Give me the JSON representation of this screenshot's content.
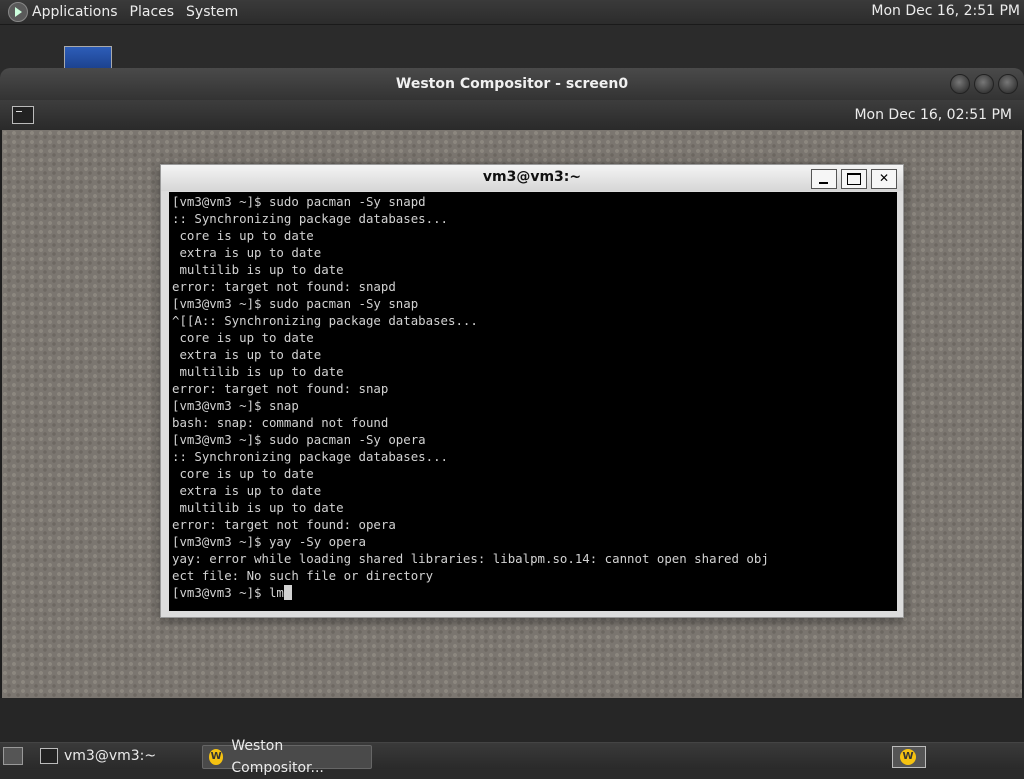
{
  "top_panel": {
    "menus": [
      "Applications",
      "Places",
      "System"
    ],
    "clock": "Mon Dec 16,  2:51 PM"
  },
  "weston": {
    "title": "Weston Compositor - screen0",
    "panel_clock": "Mon Dec 16, 02:51 PM"
  },
  "xterm": {
    "title": "vm3@vm3:~",
    "buttons": {
      "minimize": "",
      "maximize": "",
      "close": "✕"
    },
    "lines": [
      "[vm3@vm3 ~]$ sudo pacman -Sy snapd",
      ":: Synchronizing package databases...",
      " core is up to date",
      " extra is up to date",
      " multilib is up to date",
      "error: target not found: snapd",
      "[vm3@vm3 ~]$ sudo pacman -Sy snap",
      "^[[A:: Synchronizing package databases...",
      " core is up to date",
      " extra is up to date",
      " multilib is up to date",
      "error: target not found: snap",
      "[vm3@vm3 ~]$ snap",
      "bash: snap: command not found",
      "[vm3@vm3 ~]$ sudo pacman -Sy opera",
      ":: Synchronizing package databases...",
      " core is up to date",
      " extra is up to date",
      " multilib is up to date",
      "error: target not found: opera",
      "[vm3@vm3 ~]$ yay -Sy opera",
      "yay: error while loading shared libraries: libalpm.so.14: cannot open shared obj",
      "ect file: No such file or directory"
    ],
    "prompt": "[vm3@vm3 ~]$ lm"
  },
  "bottom_panel": {
    "tasks": [
      "vm3@vm3:~",
      "Weston Compositor..."
    ],
    "tray_icon": "W"
  }
}
